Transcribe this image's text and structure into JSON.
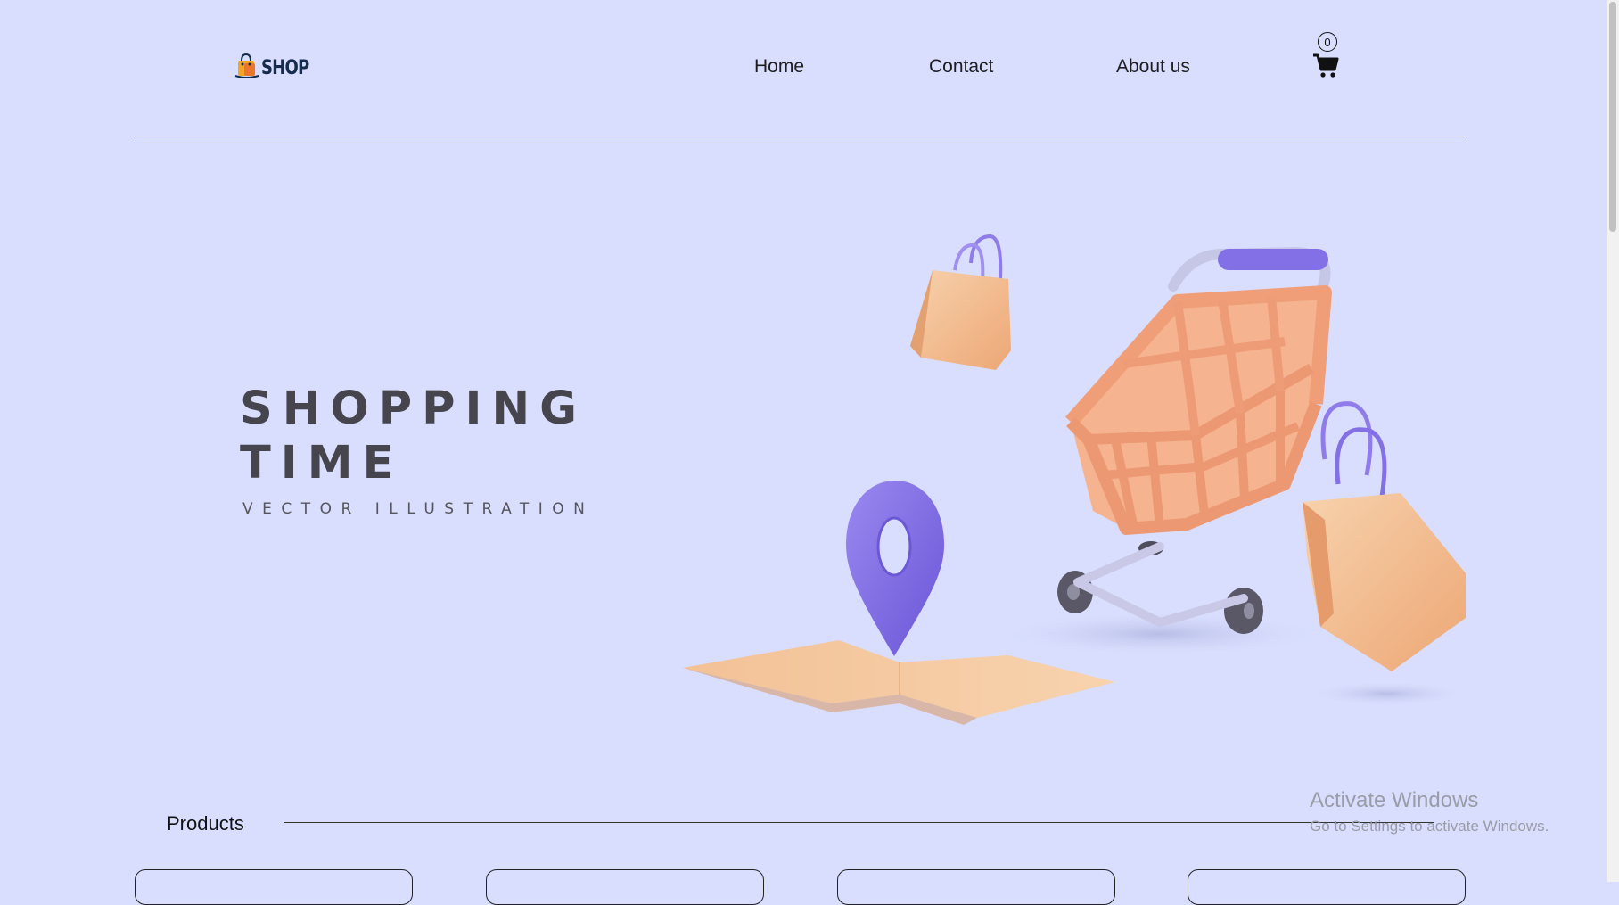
{
  "header": {
    "logo_text": "SHOP",
    "nav": [
      "Home",
      "Contact",
      "About us"
    ],
    "cart_count": "0"
  },
  "hero": {
    "title_line1": "SHOPPING",
    "title_line2": "TIME",
    "subtitle": "VECTOR ILLUSTRATION"
  },
  "products": {
    "title": "Products",
    "card_count": 4
  },
  "watermark": {
    "title": "Activate Windows",
    "subtitle": "Go to Settings to activate Windows."
  },
  "colors": {
    "background": "#d9defe",
    "cart_basket": "#f0a47c",
    "accent_purple": "#8470e6",
    "bag": "#f5c497"
  },
  "icons": [
    "shopping-bag-logo-icon",
    "shopping-cart-icon",
    "location-pin-icon"
  ]
}
